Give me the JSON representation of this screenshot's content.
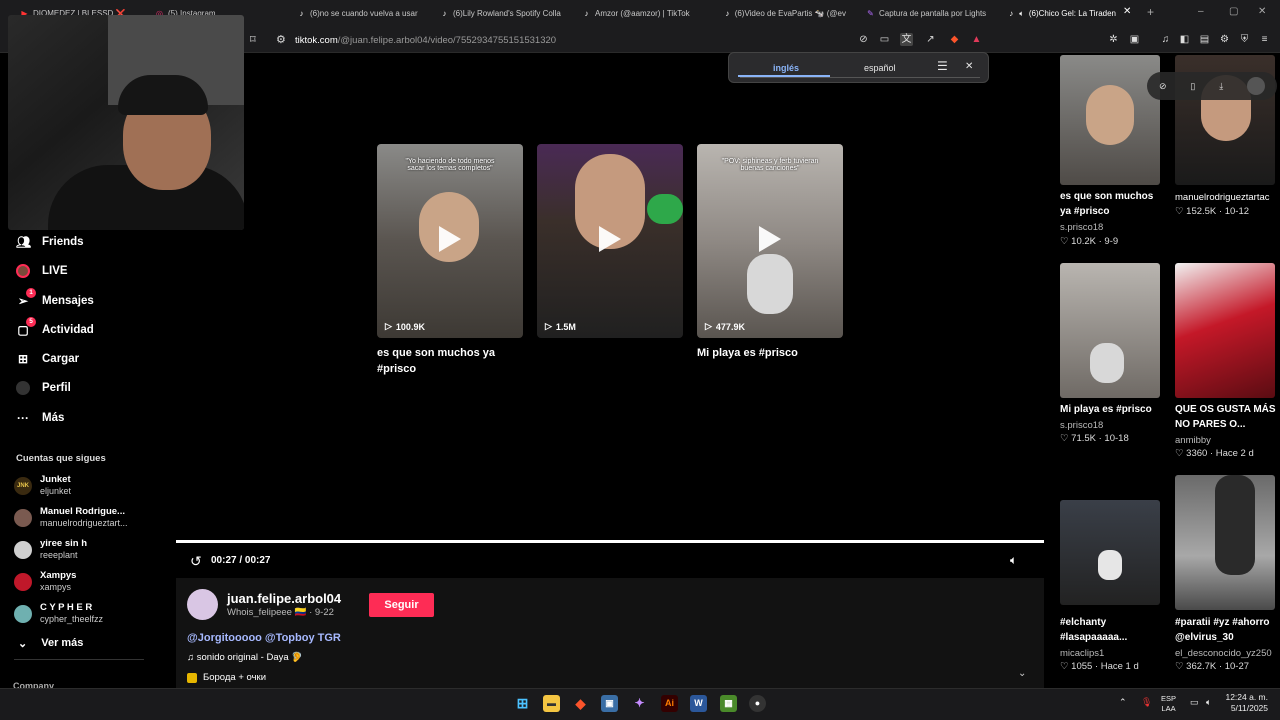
{
  "browser": {
    "tabs": [
      {
        "label": "DIOMEDEZ | BLESSD ❌",
        "icon": "youtube-icon"
      },
      {
        "label": "(5) Instagram",
        "icon": "instagram-icon"
      },
      {
        "label": "(6)no se cuando vuelva a usar",
        "icon": "tiktok-icon"
      },
      {
        "label": "(6)Lily Rowland's Spotify Colla",
        "icon": "tiktok-icon"
      },
      {
        "label": "Amzor (@aamzor) | TikTok",
        "icon": "tiktok-icon"
      },
      {
        "label": "(6)Video de EvaPartis 🐄 (@ev",
        "icon": "tiktok-icon"
      },
      {
        "label": "Captura de pantalla por Lights",
        "icon": "lightshot-icon"
      },
      {
        "label": "(6)Chico Gel: La Tiraden",
        "icon": "tiktok-icon",
        "active": true
      }
    ],
    "url_domain": "tiktok.com",
    "url_path": "/@juan.felipe.arbol04/video/7552934755151531320"
  },
  "translate": {
    "lang_a": "inglés",
    "lang_b": "español"
  },
  "sidebar": {
    "items": [
      {
        "label": "Friends",
        "icon": "friends-icon"
      },
      {
        "label": "LIVE",
        "icon": "live-icon"
      },
      {
        "label": "Mensajes",
        "icon": "messages-icon",
        "badge": "1"
      },
      {
        "label": "Actividad",
        "icon": "activity-icon",
        "badge": "5"
      },
      {
        "label": "Cargar",
        "icon": "upload-icon"
      },
      {
        "label": "Perfil",
        "icon": "profile-icon"
      },
      {
        "label": "Más",
        "icon": "more-icon"
      }
    ],
    "following_header": "Cuentas que sigues",
    "accounts": [
      {
        "name": "Junket",
        "handle": "eljunket",
        "color": "#3a2a10"
      },
      {
        "name": "Manuel Rodrigue...",
        "handle": "manuelrodrigueztart...",
        "color": "#7a5a50"
      },
      {
        "name": "yiree sin h",
        "handle": "reeeplant",
        "color": "#cfcfcf"
      },
      {
        "name": "Xampys",
        "handle": "xampys",
        "color": "#c0182a"
      },
      {
        "name": "C Y P H E R",
        "handle": "cypher_theelfzz",
        "color": "#6fb0b0"
      }
    ],
    "see_more": "Ver más",
    "company": "Company"
  },
  "endscreen": {
    "videos": [
      {
        "caption": "\"Yo haciendo de todo menos sacar los temas completos\"",
        "views": "100.9K",
        "title": "es que son muchos ya #prisco"
      },
      {
        "caption": "",
        "views": "1.5M",
        "title": ""
      },
      {
        "caption": "\"POV: siphineas y ferb tuvieran buenas canciones\"",
        "views": "477.9K",
        "title": "Mi playa es #prisco"
      }
    ]
  },
  "player": {
    "time": "00:27 / 00:27",
    "progress": 1.0
  },
  "video_info": {
    "author": "juan.felipe.arbol04",
    "author_sub": "Whois_felipeee 🇨🇴 · 9-22",
    "follow_label": "Seguir",
    "mentions": "@Jorgitooooo @Topboy TGR",
    "sound": "♫ sonido original - Daya 🦻",
    "effect": "Борода + очки"
  },
  "recommendations": [
    {
      "title": "es que son muchos ya #prisco",
      "author": "s.prisco18",
      "stats": "♡ 10.2K · 9-9"
    },
    {
      "title": "",
      "author": "manuelrodrigueztartac",
      "stats": "♡ 152.5K · 10-12"
    },
    {
      "title": "Mi playa es #prisco",
      "author": "s.prisco18",
      "stats": "♡ 71.5K · 10-18"
    },
    {
      "title": "QUE OS GUSTA MÁS NO PARES O...",
      "author": "anmibby",
      "stats": "♡ 3360 · Hace 2 d"
    },
    {
      "title": "#elchanty #lasapaaaaa...",
      "author": "micaclips1",
      "stats": "♡ 1055 · Hace 1 d"
    },
    {
      "title": "#paratii #yz #ahorro @elvirus_30",
      "author": "el_desconocido_yz250",
      "stats": "♡ 362.7K · 10-27"
    }
  ],
  "taskbar": {
    "lang_1": "ESP",
    "lang_2": "LAA",
    "time": "12:24 a. m.",
    "date": "5/11/2025"
  },
  "colors": {
    "accent": "#fe2c55",
    "mention": "#a7b9ff"
  }
}
